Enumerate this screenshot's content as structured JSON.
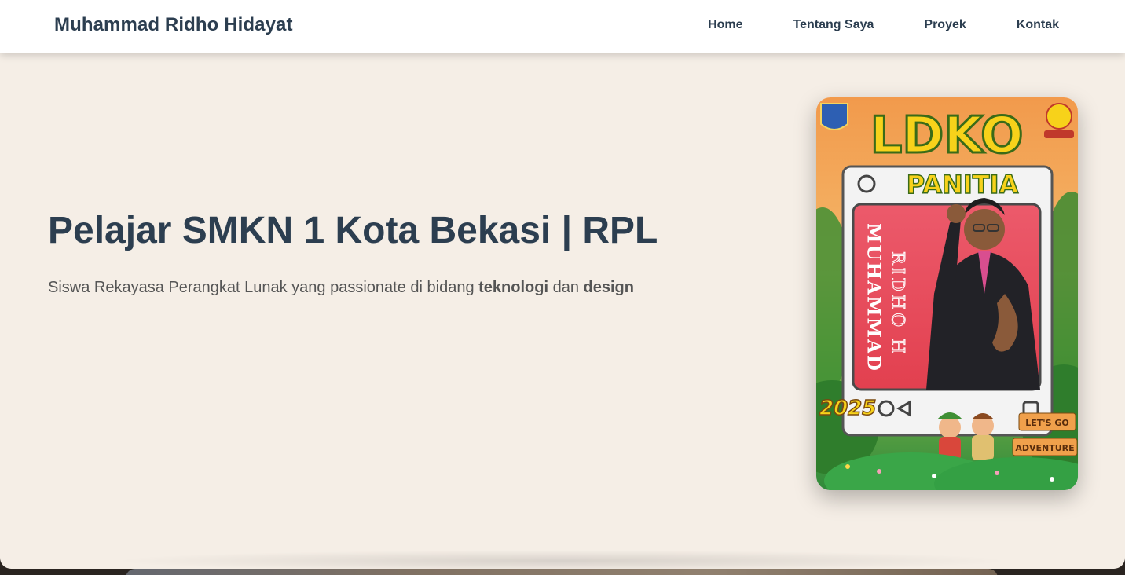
{
  "navbar": {
    "brand": "Muhammad Ridho Hidayat",
    "links": [
      "Home",
      "Tentang Saya",
      "Proyek",
      "Kontak"
    ]
  },
  "hero": {
    "title": "Pelajar SMKN 1 Kota Bekasi | RPL",
    "subtitle_prefix": "Siswa Rekayasa Perangkat Lunak yang passionate di bidang ",
    "subtitle_bold1": "teknologi",
    "subtitle_mid": " dan ",
    "subtitle_bold2": "design"
  },
  "photo": {
    "banner": "LDKO",
    "role": "PANITIA",
    "name_vertical_1": "MUHAMMAD",
    "name_vertical_2": "RIDHO H",
    "year": "2025",
    "sign_1": "LET'S GO",
    "sign_2": "ADVENTURE"
  },
  "colors": {
    "navbar_bg": "#ffffff",
    "hero_bg": "#f5eee6",
    "text_primary": "#2c3e50",
    "text_secondary": "#555555",
    "photo_red": "#e84a5f",
    "banner_yellow": "#f7d21a"
  }
}
